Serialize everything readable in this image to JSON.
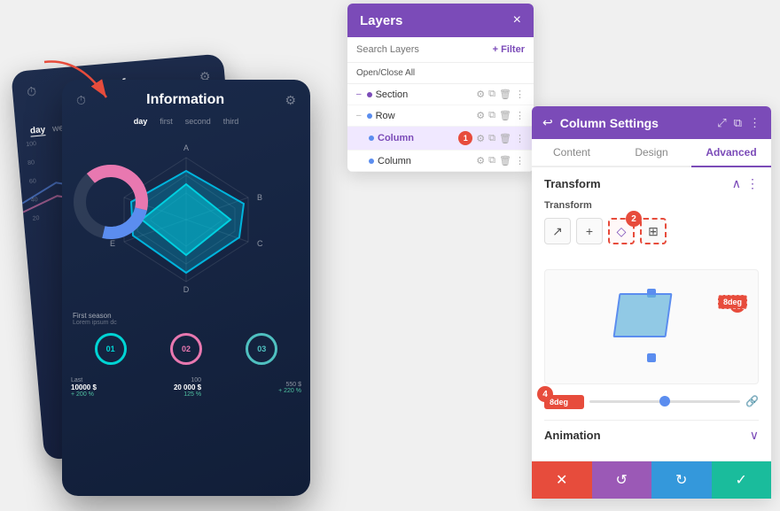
{
  "background": "#f0f0f0",
  "arrow": {
    "color": "#e74c3c"
  },
  "cards": {
    "back_title": "Inf",
    "back_subtitle": "day",
    "back_tabs": [
      "day",
      "week"
    ],
    "main_title": "Information",
    "main_tabs": [
      "day",
      "first",
      "second",
      "third"
    ],
    "season_label": "First season",
    "season_desc": "Lorem ipsum dc",
    "stats": [
      {
        "label": "01",
        "color": "cyan"
      },
      {
        "label": "02",
        "color": "pink"
      },
      {
        "label": "03",
        "color": "teal"
      }
    ],
    "data_rows": [
      {
        "label": "Last",
        "value": "10000 $",
        "change": "+ 200 %",
        "positive": true
      },
      {
        "label": "",
        "value": "20 000 $",
        "change": "125 %",
        "positive": true
      }
    ]
  },
  "layers": {
    "title": "Layers",
    "close_label": "×",
    "search_placeholder": "Search Layers",
    "filter_label": "+ Filter",
    "open_close_label": "Open/Close All",
    "items": [
      {
        "name": "Section",
        "active": false,
        "dot": "purple",
        "sub": false,
        "badge": null
      },
      {
        "name": "Row",
        "active": false,
        "dot": "blue",
        "sub": false,
        "badge": null
      },
      {
        "name": "Column",
        "active": true,
        "dot": "blue",
        "sub": true,
        "badge": "1"
      },
      {
        "name": "Column",
        "active": false,
        "dot": "blue",
        "sub": true,
        "badge": null
      }
    ],
    "icon_labels": [
      "⚙",
      "⧉",
      "🗑",
      "⋮"
    ]
  },
  "settings": {
    "title": "Column Settings",
    "back_icon": "↩",
    "header_icons": [
      "⤢",
      "⧉",
      "⋮"
    ],
    "tabs": [
      "Content",
      "Design",
      "Advanced"
    ],
    "active_tab": "Advanced",
    "transform_section": "Transform",
    "transform_label": "Transform",
    "transform_icons": [
      "↗",
      "+",
      "◇",
      "⊞"
    ],
    "active_transform_icon": 2,
    "deg_value": "8deg",
    "animation_section": "Animation",
    "badges": {
      "badge2": "2",
      "badge3": "3",
      "badge4": "4"
    }
  },
  "action_bar": {
    "cancel_icon": "✕",
    "reset_icon": "↺",
    "redo_icon": "↻",
    "confirm_icon": "✓"
  }
}
